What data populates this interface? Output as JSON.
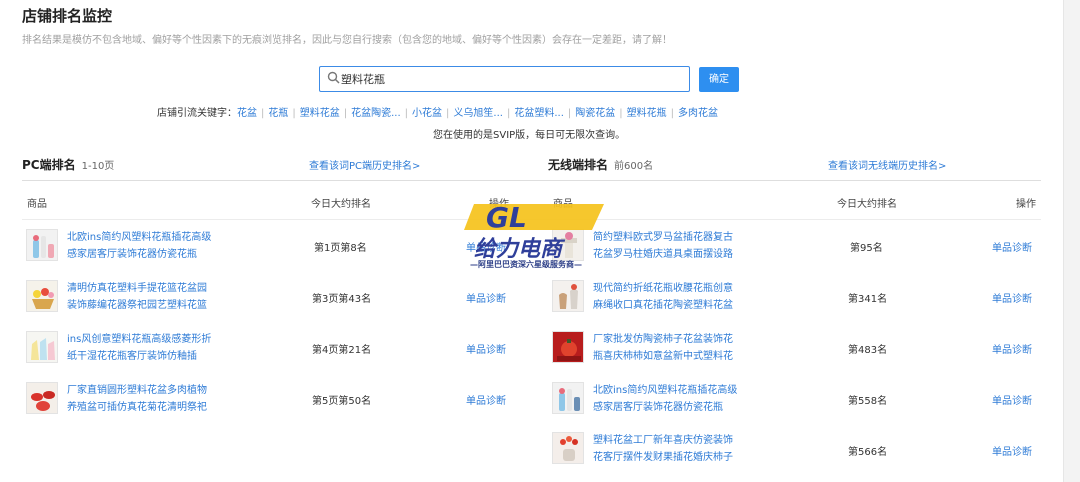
{
  "page": {
    "title": "店铺排名监控",
    "note": "排名结果是模仿不包含地域、偏好等个性因素下的无痕浏览排名，因此与您自行搜索（包含您的地域、偏好等个性因素）会存在一定差距，请了解！"
  },
  "search": {
    "value": "塑料花瓶",
    "confirm_label": "确定"
  },
  "keywords": {
    "label": "店铺引流关键字：",
    "items": [
      "花盆",
      "花瓶",
      "塑料花盆",
      "花盆陶瓷...",
      "小花盆",
      "义乌旭笙...",
      "花盆塑料...",
      "陶瓷花盆",
      "塑料花瓶",
      "多肉花盆"
    ]
  },
  "svip_note": "您在使用的是SVIP版，每日可无限次查询。",
  "pc": {
    "title": "PC端排名",
    "sub": "1-10页",
    "history_link": "查看该词PC端历史排名>",
    "col_product": "商品",
    "col_rank": "今日大约排名",
    "col_action": "操作",
    "rows": [
      {
        "title": "北欧ins简约风塑料花瓶插花高级感家居客厅装饰花器仿瓷花瓶",
        "rank": "第1页第8名",
        "action": "单品诊断"
      },
      {
        "title": "清明仿真花塑料手提花篮花盆园装饰藤编花器祭祀园艺塑料花篮",
        "rank": "第3页第43名",
        "action": "单品诊断"
      },
      {
        "title": "ins风创意塑料花瓶高级感菱形折纸干湿花花瓶客厅装饰仿釉插",
        "rank": "第4页第21名",
        "action": "单品诊断"
      },
      {
        "title": "厂家直销圆形塑料花盆多肉植物养殖盆可插仿真花菊花清明祭祀",
        "rank": "第5页第50名",
        "action": "单品诊断"
      }
    ]
  },
  "mobile": {
    "title": "无线端排名",
    "sub": "前600名",
    "history_link": "查看该词无线端历史排名>",
    "col_product": "商品",
    "col_rank": "今日大约排名",
    "col_action": "操作",
    "rows": [
      {
        "title": "简约塑料欧式罗马盆插花器复古花盆罗马柱婚庆道具桌面摆设路",
        "rank": "第95名",
        "action": "单品诊断"
      },
      {
        "title": "现代简约折纸花瓶收腰花瓶创意麻绳收口真花插花陶瓷塑料花盆",
        "rank": "第341名",
        "action": "单品诊断"
      },
      {
        "title": "厂家批发仿陶瓷柿子花盆装饰花瓶喜庆柿柿如意盆新中式塑料花",
        "rank": "第483名",
        "action": "单品诊断"
      },
      {
        "title": "北欧ins简约风塑料花瓶插花高级感家居客厅装饰花器仿瓷花瓶",
        "rank": "第558名",
        "action": "单品诊断"
      },
      {
        "title": "塑料花盆工厂新年喜庆仿瓷装饰花客厅摆件发财果插花婚庆柿子",
        "rank": "第566名",
        "action": "单品诊断"
      }
    ]
  },
  "watermark": {
    "logo_text": "GL",
    "name": "给力电商",
    "sub": "—阿里巴巴资深六星级服务商—"
  }
}
